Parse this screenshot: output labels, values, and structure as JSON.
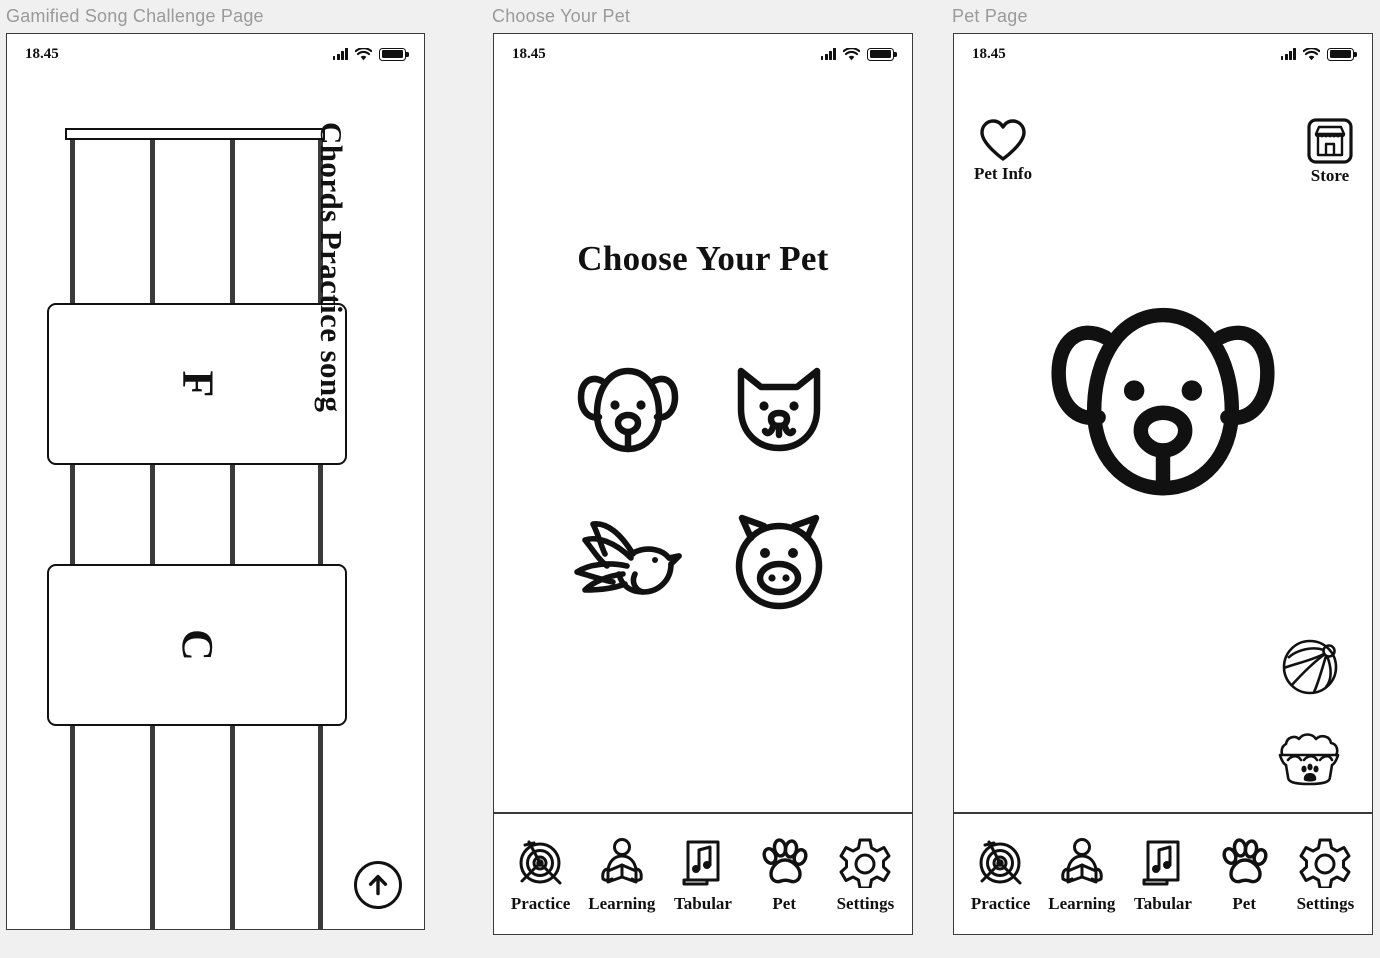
{
  "background_color": "#f0f0f0",
  "ink_color": "#111111",
  "caption_color": "#9a9a9a",
  "panels": [
    {
      "caption": "Gamified Song Challenge Page"
    },
    {
      "caption": "Choose Your Pet"
    },
    {
      "caption": "Pet Page"
    }
  ],
  "status_bar": {
    "time": "18.45",
    "icons": [
      "signal-bars-icon",
      "wifi-icon",
      "battery-icon"
    ],
    "battery_full": true
  },
  "panel1": {
    "vertical_title": "Chords Practice song",
    "fretboard": {
      "strings": 4,
      "nut": true
    },
    "chord_cards": [
      {
        "label": "F"
      },
      {
        "label": "C"
      }
    ],
    "scroll_button": {
      "icon": "arrow-up-circle-icon"
    }
  },
  "panel2": {
    "title": "Choose Your Pet",
    "pets": [
      {
        "name": "Dog",
        "icon": "dog-face-icon"
      },
      {
        "name": "Cat",
        "icon": "cat-face-icon"
      },
      {
        "name": "Bird",
        "icon": "bird-icon"
      },
      {
        "name": "Pig",
        "icon": "pig-face-icon"
      }
    ]
  },
  "panel3": {
    "top_actions": [
      {
        "label": "Pet Info",
        "icon": "heart-icon"
      },
      {
        "label": "Store",
        "icon": "store-icon"
      }
    ],
    "active_pet": {
      "name": "Dog",
      "icon": "dog-face-icon"
    },
    "side_items": [
      {
        "name": "Ball",
        "icon": "beach-ball-icon"
      },
      {
        "name": "Food Bowl",
        "icon": "pet-food-bowl-icon"
      }
    ]
  },
  "navbar": {
    "items": [
      {
        "label": "Practice",
        "icon": "target-dart-icon"
      },
      {
        "label": "Learning",
        "icon": "person-reading-book-icon"
      },
      {
        "label": "Tabular",
        "icon": "music-note-laptop-icon"
      },
      {
        "label": "Pet",
        "icon": "paw-print-icon"
      },
      {
        "label": "Settings",
        "icon": "gear-icon"
      }
    ]
  }
}
